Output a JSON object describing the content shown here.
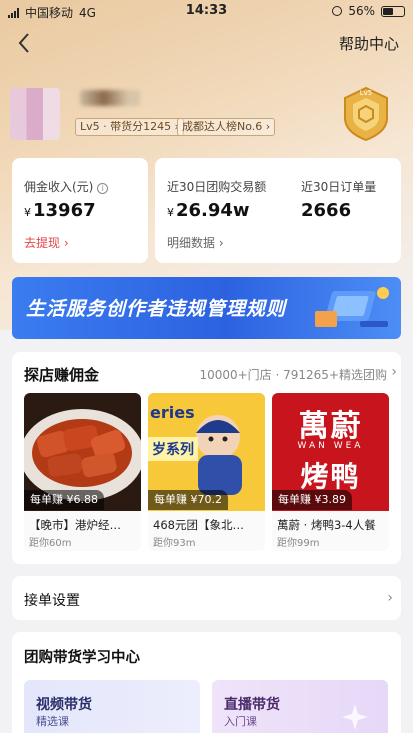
{
  "status_bar": {
    "carrier": "中国移动",
    "network": "4G",
    "time": "14:33",
    "battery": "56%",
    "battery_level": 0.56
  },
  "nav": {
    "help": "帮助中心"
  },
  "profile": {
    "level_score": "Lv5 · 带货分1245",
    "ranking": "成都达人榜No.6",
    "badge": "Lv5"
  },
  "stats": {
    "commission_label": "佣金收入(元)",
    "commission_value": "13967",
    "withdraw": "去提现",
    "gmv_label": "近30日团购交易额",
    "gmv_value": "26.94w",
    "orders_label": "近30日订单量",
    "orders_value": "2666",
    "detail": "明细数据",
    "currency": "¥"
  },
  "banner": {
    "text": "生活服务创作者违规管理规则"
  },
  "shops": {
    "title": "探店赚佣金",
    "subtitle": "10000+门店 · 791265+精选团购",
    "items": [
      {
        "earn": "每单赚 ¥6.88",
        "name": "【晚市】港炉经…",
        "distance": "距你60m"
      },
      {
        "earn": "每单赚 ¥70.2",
        "name": "468元团【象北…",
        "distance": "距你93m"
      },
      {
        "earn": "每单赚 ¥3.89",
        "name": "萬蔚 · 烤鸭3-4人餐",
        "distance": "距你99m"
      }
    ],
    "img2_text_top": "eries",
    "img2_text_mid": "岁系列",
    "img3_line1": "萬蔚",
    "img3_line2": "WAN WEA",
    "img3_line3": "烤鸭"
  },
  "settings": {
    "title": "接单设置"
  },
  "learning": {
    "title": "团购带货学习中心",
    "cards": [
      {
        "title": "视频带货",
        "sub": "精选课"
      },
      {
        "title": "直播带货",
        "sub": "入门课"
      }
    ]
  }
}
